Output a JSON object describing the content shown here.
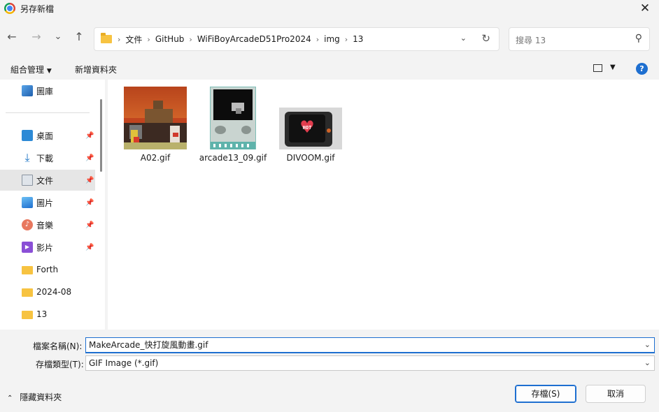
{
  "window": {
    "title": "另存新檔",
    "close": "✕"
  },
  "nav": {
    "back": "←",
    "forward": "→",
    "recent": "⌄",
    "up": "↑",
    "breadcrumbs": [
      "文件",
      "GitHub",
      "WiFiBoyArcadeD51Pro2024",
      "img",
      "13"
    ],
    "search_placeholder": "搜尋 13"
  },
  "toolbar": {
    "organize": "組合管理",
    "new_folder": "新增資料夾",
    "help": "?"
  },
  "sidebar": {
    "items": [
      {
        "label": "圖庫",
        "icon": "gallery-icon",
        "pinned": false
      },
      {
        "label": "桌面",
        "icon": "desktop-icon",
        "pinned": true
      },
      {
        "label": "下載",
        "icon": "download-icon",
        "pinned": true
      },
      {
        "label": "文件",
        "icon": "documents-icon",
        "pinned": true,
        "active": true
      },
      {
        "label": "圖片",
        "icon": "pictures-icon",
        "pinned": true
      },
      {
        "label": "音樂",
        "icon": "music-icon",
        "pinned": true
      },
      {
        "label": "影片",
        "icon": "videos-icon",
        "pinned": true
      },
      {
        "label": "Forth",
        "icon": "folder-icon",
        "pinned": false
      },
      {
        "label": "2024-08",
        "icon": "folder-icon",
        "pinned": false
      },
      {
        "label": "13",
        "icon": "folder-icon",
        "pinned": false
      }
    ]
  },
  "files": [
    {
      "name": "A02.gif"
    },
    {
      "name": "arcade13_09.gif"
    },
    {
      "name": "DIVOOM.gif"
    }
  ],
  "thumb_text": {
    "hot": "HOT"
  },
  "footer": {
    "filename_label": "檔案名稱(N):",
    "filename_value": "MakeArcade_快打旋風動畫.gif",
    "filetype_label": "存檔類型(T):",
    "filetype_value": "GIF Image (*.gif)",
    "hide_folders": "隱藏資料夾",
    "save": "存檔(S)",
    "cancel": "取消"
  }
}
